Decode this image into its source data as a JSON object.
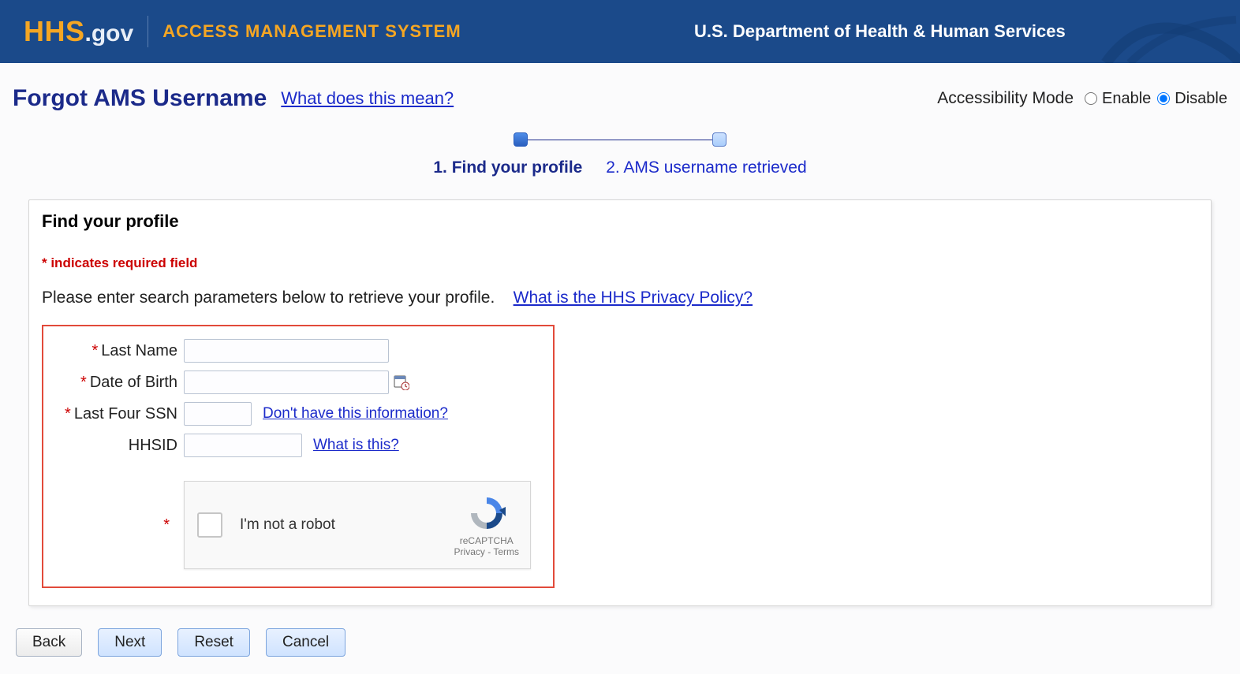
{
  "header": {
    "logo_hhs": "HHS",
    "logo_gov": ".gov",
    "app_name": "ACCESS MANAGEMENT SYSTEM",
    "department": "U.S. Department of Health & Human Services"
  },
  "title_row": {
    "page_title": "Forgot AMS Username",
    "help_link": "What does this mean?",
    "accessibility_label": "Accessibility Mode",
    "enable_label": "Enable",
    "disable_label": "Disable",
    "selected": "disable"
  },
  "stepper": {
    "step1": "1. Find your profile",
    "step2": "2. AMS username retrieved"
  },
  "panel": {
    "title": "Find your profile",
    "required_note": "* indicates required field",
    "instruction": "Please enter search parameters below to retrieve your profile.",
    "privacy_link": "What is the HHS Privacy Policy?"
  },
  "form": {
    "last_name": {
      "label": "Last Name",
      "value": "",
      "required": true
    },
    "dob": {
      "label": "Date of Birth",
      "value": "",
      "required": true
    },
    "ssn": {
      "label": "Last Four SSN",
      "value": "",
      "required": true,
      "help": "Don't have this information?"
    },
    "hhsid": {
      "label": "HHSID",
      "value": "",
      "required": false,
      "help": "What is this?"
    }
  },
  "captcha": {
    "label": "I'm not a robot",
    "brand": "reCAPTCHA",
    "legal": "Privacy - Terms"
  },
  "buttons": {
    "back": "Back",
    "next": "Next",
    "reset": "Reset",
    "cancel": "Cancel"
  }
}
